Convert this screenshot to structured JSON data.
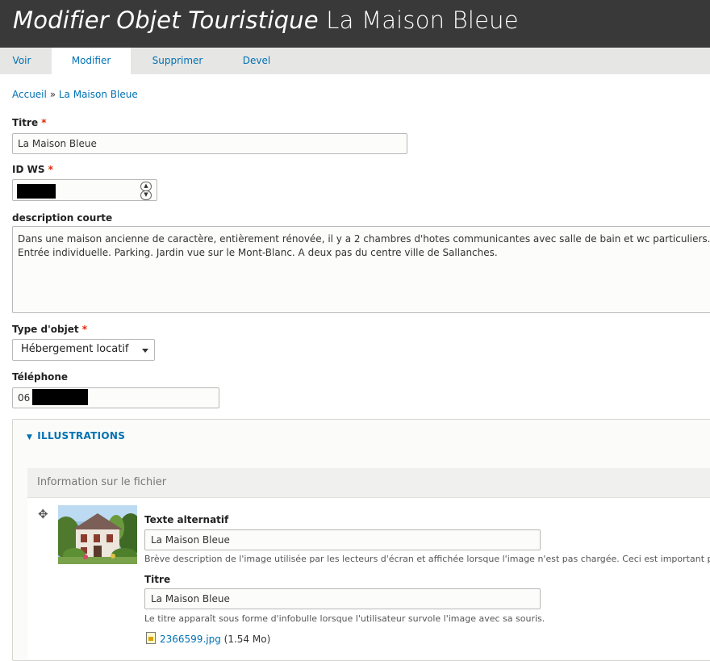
{
  "header": {
    "title_type": "Modifier Objet Touristique",
    "title_name": "La Maison Bleue"
  },
  "tabs": [
    {
      "label": "Voir"
    },
    {
      "label": "Modifier"
    },
    {
      "label": "Supprimer"
    },
    {
      "label": "Devel"
    }
  ],
  "breadcrumb": {
    "home": "Accueil",
    "separator": "»",
    "current": "La Maison Bleue"
  },
  "form": {
    "required_mark": "*",
    "titre": {
      "label": "Titre",
      "value": "La Maison Bleue"
    },
    "id_ws": {
      "label": "ID WS"
    },
    "description": {
      "label": "description courte",
      "value": "Dans une maison ancienne de caractère, entièrement rénovée, il y a 2 chambres d'hotes communicantes avec salle de bain et wc particuliers. Entrée individuelle. Parking. Jardin vue sur le Mont-Blanc. A deux pas du centre ville de Sallanches."
    },
    "type_objet": {
      "label": "Type d'objet",
      "value": "Hébergement locatif"
    },
    "telephone": {
      "label": "Téléphone",
      "value_prefix": "06"
    }
  },
  "illustrations": {
    "legend": "Illustrations",
    "file_header": "Information sur le fichier",
    "alt": {
      "label": "Texte alternatif",
      "value": "La Maison Bleue",
      "description": "Brève description de l'image utilisée par les lecteurs d'écran et affichée lorsque l'image n'est pas chargée. Ceci est important p"
    },
    "title": {
      "label": "Titre",
      "value": "La Maison Bleue",
      "description": "Le titre apparaît sous forme d'infobulle lorsque l'utilisateur survole l'image avec sa souris."
    },
    "file": {
      "name": "2366599.jpg",
      "size": "(1.54 Mo)"
    }
  },
  "colors": {
    "header_bg": "#393939",
    "link": "#0071b3",
    "required": "#e32700"
  }
}
